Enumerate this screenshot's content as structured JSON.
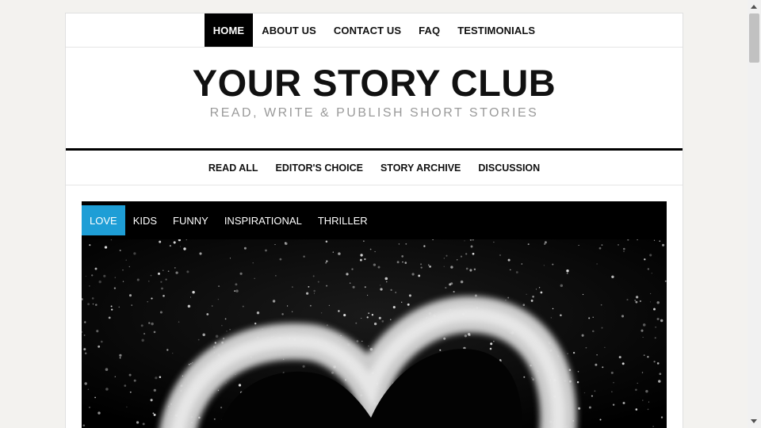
{
  "top_nav": {
    "items": [
      {
        "label": "HOME",
        "active": true
      },
      {
        "label": "ABOUT US"
      },
      {
        "label": "CONTACT US"
      },
      {
        "label": "FAQ"
      },
      {
        "label": "TESTIMONIALS"
      }
    ]
  },
  "site": {
    "title": "YOUR STORY CLUB",
    "tagline": "READ, WRITE & PUBLISH SHORT STORIES"
  },
  "sub_nav": {
    "items": [
      {
        "label": "READ ALL"
      },
      {
        "label": "EDITOR'S CHOICE"
      },
      {
        "label": "STORY ARCHIVE"
      },
      {
        "label": "DISCUSSION"
      }
    ]
  },
  "categories": {
    "items": [
      {
        "label": "LOVE",
        "active": true
      },
      {
        "label": "KIDS"
      },
      {
        "label": "FUNNY"
      },
      {
        "label": "INSPIRATIONAL"
      },
      {
        "label": "THRILLER"
      }
    ]
  },
  "colors": {
    "accent": "#1e9ed6",
    "nav_active_bg": "#000000",
    "page_bg": "#f3f2ef"
  },
  "hero": {
    "image": "heart-drawn-in-salt-image"
  }
}
